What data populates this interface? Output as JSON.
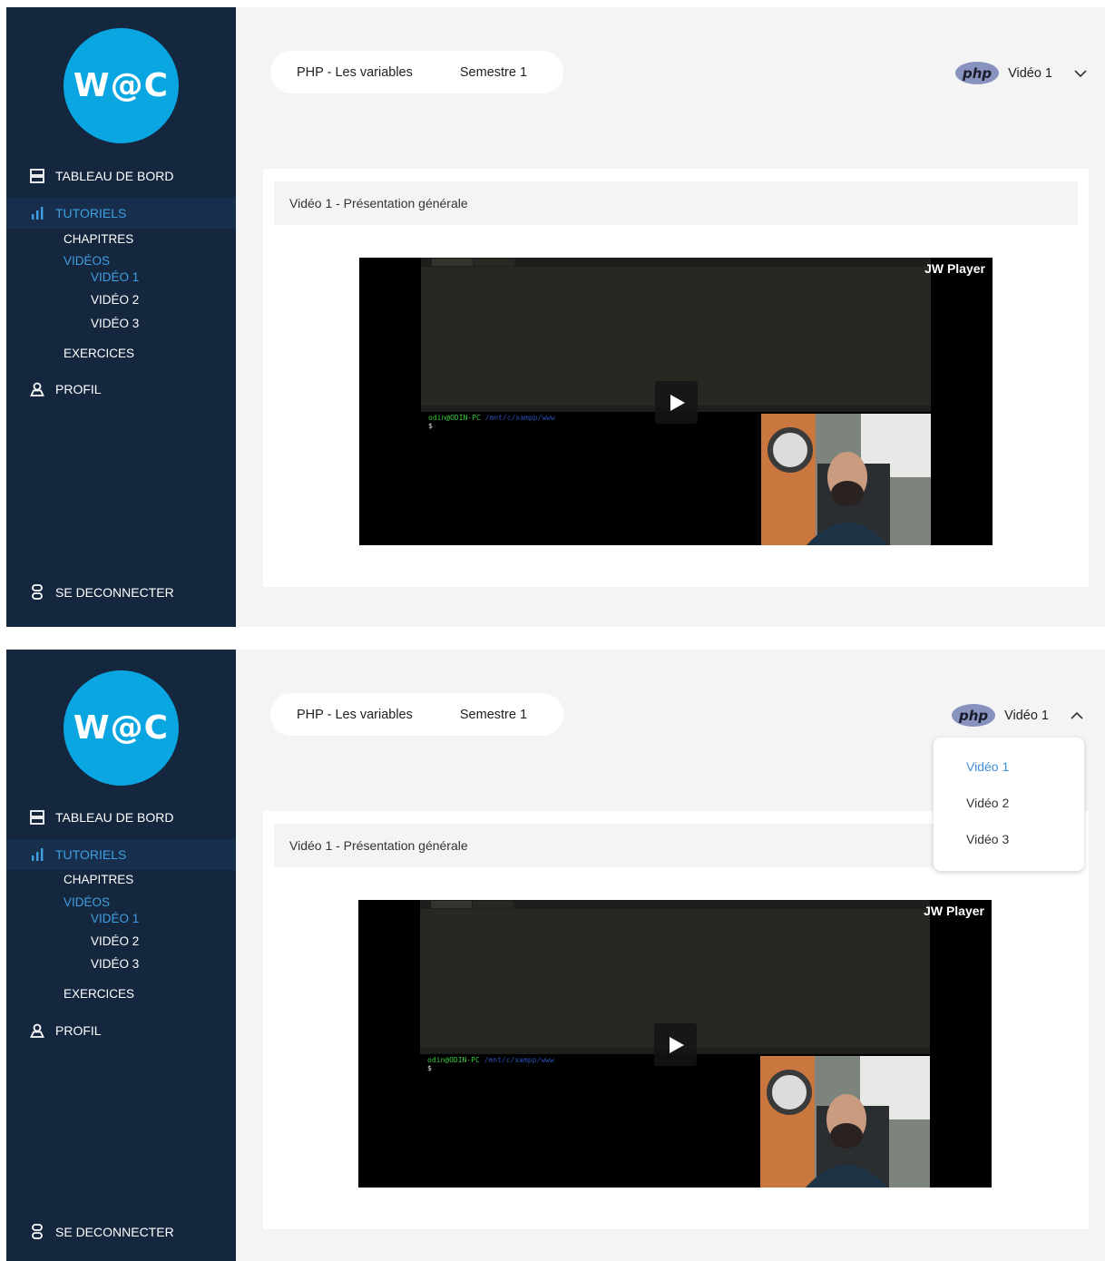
{
  "logo_text": "W@C",
  "nav": {
    "dashboard": "TABLEAU DE BORD",
    "tutorials": "TUTORIELS",
    "chapters": "CHAPITRES",
    "videos": "VIDÉOS",
    "video_items": [
      "VIDÉO 1",
      "VIDÉO 2",
      "VIDÉO 3"
    ],
    "exercises": "EXERCICES",
    "profile": "PROFIL",
    "logout": "SE DECONNECTER"
  },
  "breadcrumb": {
    "course": "PHP - Les variables",
    "semester": "Semestre 1"
  },
  "selector": {
    "badge": "php",
    "current": "Vidéo 1"
  },
  "panel_title": "Vidéo 1 - Présentation générale",
  "player": {
    "brand": "JW Player",
    "terminal_user": "odin@ODIN-PC",
    "terminal_path": "/mnt/c/xampp/www",
    "prompt": "$"
  },
  "dropdown": {
    "options": [
      "Vidéo 1",
      "Vidéo 2",
      "Vidéo 3"
    ],
    "selected": "Vidéo 1"
  },
  "colors": {
    "sidebar": "#14273f",
    "accent": "#3f9fe0",
    "logo": "#0aa6e2",
    "background": "#f4f4f4"
  }
}
